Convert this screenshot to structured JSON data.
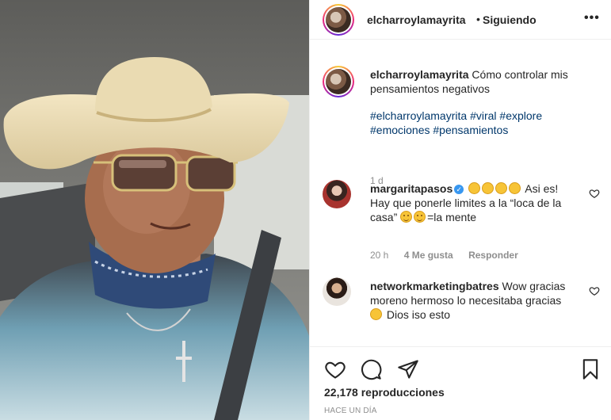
{
  "post": {
    "username": "elcharroylamayrita",
    "follow_separator": "•",
    "follow_status": "Siguiendo",
    "more_icon": "more-options-icon",
    "caption": {
      "username": "elcharroylamayrita",
      "text": "Cómo controlar mis pensamientos negativos",
      "hashtags": [
        "#elcharroylamayrita",
        "#viral",
        "#explore",
        "#emociones",
        "#pensamientos"
      ],
      "time": "1 d"
    },
    "comments": [
      {
        "username": "margaritapasos",
        "verified": true,
        "emoji_prefix": "👏👏👏👏",
        "text_line1": "Asi es! Hay que ponerle limites a la “loca de la casa”",
        "text_tail": "=la mente",
        "time": "20 h",
        "likes": "4 Me gusta",
        "reply": "Responder"
      },
      {
        "username": "networkmarketingbatres",
        "text": "Wow gracias moreno hermoso lo necesitaba gracias",
        "text_tail": "Dios iso esto"
      }
    ],
    "views_count": "22,178",
    "views_label": "reproducciones",
    "posted": "HACE UN DÍA"
  },
  "colors": {
    "link": "#00376b",
    "muted": "#8e8e8e",
    "verified": "#3897f0"
  }
}
